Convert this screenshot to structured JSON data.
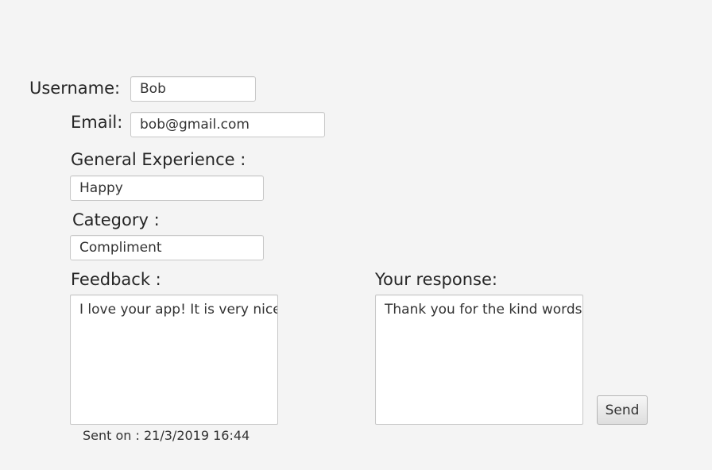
{
  "form": {
    "username": {
      "label": "Username:",
      "value": "Bob"
    },
    "email": {
      "label": "Email:",
      "value": "bob@gmail.com"
    },
    "experience": {
      "label": "General Experience :",
      "value": "Happy"
    },
    "category": {
      "label": "Category :",
      "value": "Compliment"
    },
    "feedback": {
      "label": "Feedback :",
      "value": "I love your app! It is very nice!",
      "sent_on": "Sent on : 21/3/2019 16:44"
    },
    "response": {
      "label": "Your response:",
      "value": "Thank you for the kind words!"
    },
    "send_label": "Send"
  }
}
